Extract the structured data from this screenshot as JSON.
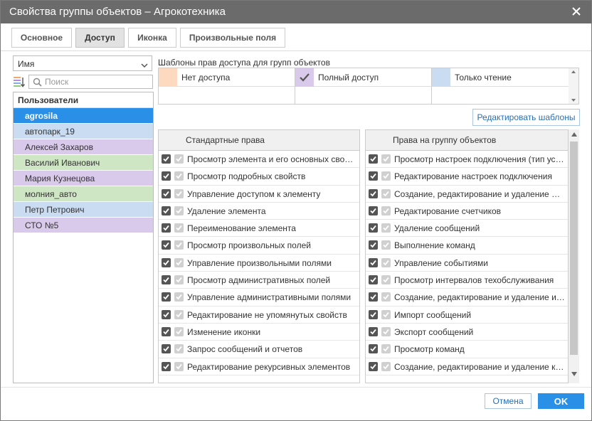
{
  "window": {
    "title": "Свойства группы объектов – Агрокотехника"
  },
  "tabs": [
    {
      "label": "Основное"
    },
    {
      "label": "Доступ"
    },
    {
      "label": "Иконка"
    },
    {
      "label": "Произвольные поля"
    }
  ],
  "active_tab": "Доступ",
  "sort": {
    "value": "Имя"
  },
  "search": {
    "placeholder": "Поиск",
    "value": ""
  },
  "users": {
    "header": "Пользователи",
    "items": [
      {
        "name": "agrosila",
        "color": "#2a8fe6",
        "selected": true
      },
      {
        "name": "автопарк_19",
        "color": "#c9dcf2"
      },
      {
        "name": "Алексей Захаров",
        "color": "#d9c9ea"
      },
      {
        "name": "Василий Иванович",
        "color": "#cfe6c5"
      },
      {
        "name": "Мария Кузнецова",
        "color": "#d9c9ea"
      },
      {
        "name": "молния_авто",
        "color": "#cfe6c5"
      },
      {
        "name": "Петр Петрович",
        "color": "#c9dcf2"
      },
      {
        "name": "СТО №5",
        "color": "#d9c9ea"
      }
    ]
  },
  "templates": {
    "label": "Шаблоны прав доступа для групп объектов",
    "items": [
      {
        "name": "Нет доступа",
        "color": "#fcd9bf"
      },
      {
        "name": "Полный доступ",
        "color": "#d9c9ea",
        "checked": true
      },
      {
        "name": "Только чтение",
        "color": "#c9dcf2"
      }
    ],
    "edit_button": "Редактировать шаблоны"
  },
  "standard_rights": {
    "header": "Стандартные права",
    "items": [
      "Просмотр элемента и его основных свойств",
      "Просмотр подробных свойств",
      "Управление доступом к элементу",
      "Удаление элемента",
      "Переименование элемента",
      "Просмотр произвольных полей",
      "Управление произвольными полями",
      "Просмотр административных полей",
      "Управление административными полями",
      "Редактирование не упомянутых свойств",
      "Изменение иконки",
      "Запрос сообщений и отчетов",
      "Редактирование рекурсивных элементов"
    ]
  },
  "group_rights": {
    "header": "Права на группу объектов",
    "items": [
      "Просмотр настроек подключения (тип устройства)",
      "Редактирование настроек подключения",
      "Создание, редактирование и удаление датчиков",
      "Редактирование счетчиков",
      "Удаление сообщений",
      "Выполнение команд",
      "Управление событиями",
      "Просмотр интервалов техобслуживания",
      "Создание, редактирование и удаление интервалов",
      "Импорт сообщений",
      "Экспорт сообщений",
      "Просмотр команд",
      "Создание, редактирование и удаление команд"
    ]
  },
  "footer": {
    "cancel": "Отмена",
    "ok": "OK"
  },
  "colors": {
    "titlebar": "#6b6b6b",
    "accent": "#2a8fe6",
    "link": "#2a6fb5"
  }
}
